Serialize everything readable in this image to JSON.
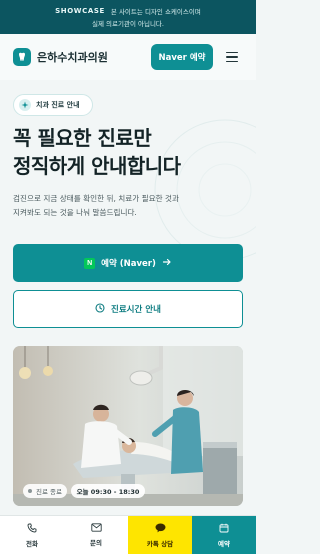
{
  "notice": {
    "tag": "SHOWCASE",
    "line1": "본 사이트는 디자인 쇼케이스이며",
    "line2": "실제 의료기관이 아닙니다."
  },
  "header": {
    "logo_name": "은하수치과의원",
    "naver_button": "Naver 예약",
    "logo_icon": "tooth-icon",
    "menu_icon": "hamburger-menu-icon"
  },
  "hero": {
    "badge": "치과 진료 안내",
    "headline": [
      "꼭 필요한 진료만",
      "정직하게 안내합니다"
    ],
    "description": [
      "검진으로 지금 상태를 확인한 뒤, 치료가 필요한 것과",
      "지켜봐도 되는 것을 나눠 말씀드립니다."
    ],
    "primary_cta": "예약 (Naver)",
    "primary_cta_badge": "N",
    "secondary_cta": "진료시간 안내",
    "photo": {
      "status": "진료 종료",
      "hours": "오늘 09:30 - 18:30"
    }
  },
  "bottom_nav": [
    {
      "label": "전화",
      "icon": "phone-icon"
    },
    {
      "label": "문의",
      "icon": "mail-icon"
    },
    {
      "label": "카톡 상담",
      "icon": "chat-bubble-icon"
    },
    {
      "label": "예약",
      "icon": "calendar-icon"
    }
  ],
  "colors": {
    "brand": "#0e8f94",
    "notice_bg": "#0c5560",
    "kakao": "#fee500",
    "naver": "#03c75a"
  }
}
